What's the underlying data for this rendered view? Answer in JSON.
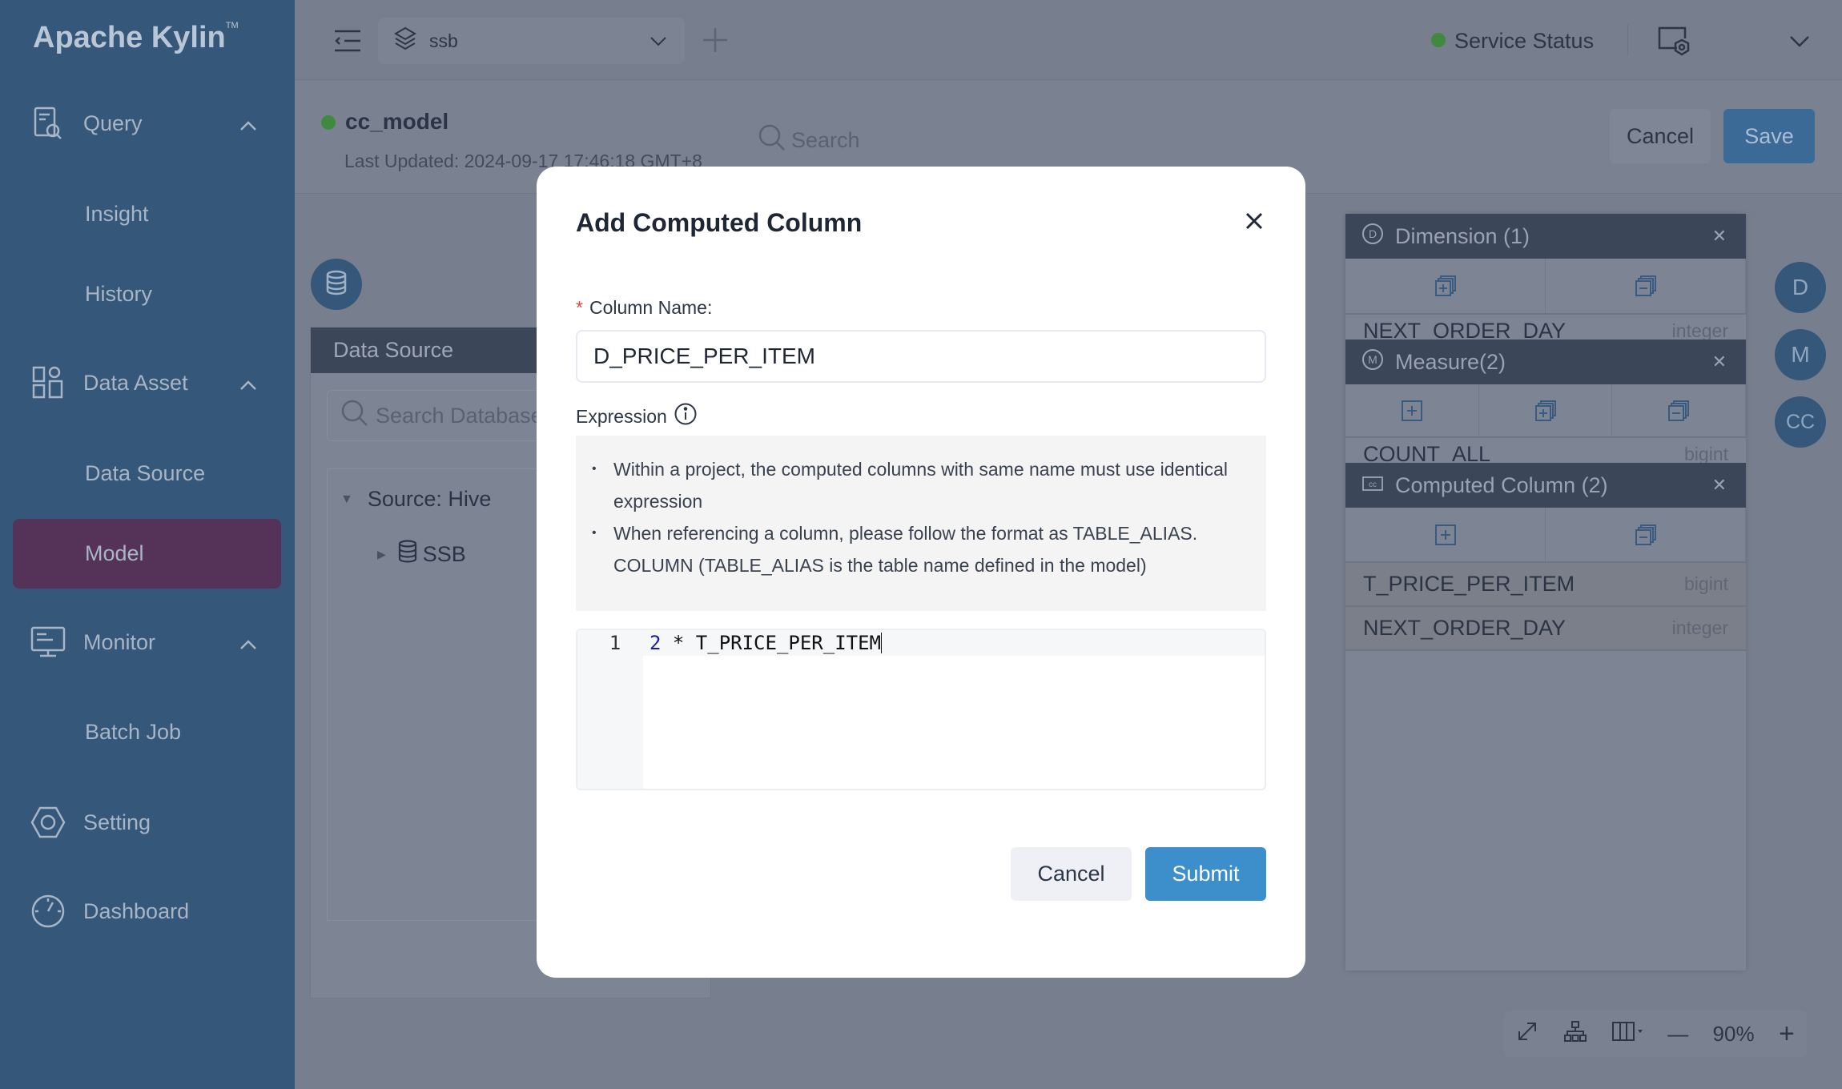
{
  "app": {
    "logo": "Apache Kylin",
    "tm": "TM"
  },
  "sidebar": {
    "items": [
      {
        "label": "Query",
        "icon": "query-icon",
        "expanded": true
      },
      {
        "label": "Insight"
      },
      {
        "label": "History"
      },
      {
        "label": "Data Asset",
        "icon": "data-asset-icon",
        "expanded": true
      },
      {
        "label": "Data Source"
      },
      {
        "label": "Model",
        "active": true
      },
      {
        "label": "Monitor",
        "icon": "monitor-icon",
        "expanded": true
      },
      {
        "label": "Batch Job"
      },
      {
        "label": "Setting",
        "icon": "setting-icon"
      },
      {
        "label": "Dashboard",
        "icon": "dashboard-icon"
      }
    ]
  },
  "header": {
    "project": "ssb",
    "service_status": "Service Status",
    "status_color": "#3f8a3f"
  },
  "model": {
    "name": "cc_model",
    "last_updated": "Last Updated: 2024-09-17 17:46:18 GMT+8",
    "search_placeholder": "Search",
    "cancel": "Cancel",
    "save": "Save"
  },
  "datasource": {
    "title": "Data Source",
    "search_placeholder": "Search Database/Table",
    "source": "Source: Hive",
    "db": "SSB"
  },
  "panel": {
    "dimension": {
      "title": "Dimension (1)",
      "rows": [
        {
          "name": "NEXT_ORDER_DAY",
          "type": "integer"
        }
      ]
    },
    "measure": {
      "title": "Measure(2)",
      "rows": [
        {
          "name": "COUNT_ALL",
          "type": "bigint"
        }
      ]
    },
    "computed": {
      "title": "Computed Column (2)",
      "rows": [
        {
          "name": "T_PRICE_PER_ITEM",
          "type": "bigint"
        },
        {
          "name": "NEXT_ORDER_DAY",
          "type": "integer"
        }
      ]
    }
  },
  "side_circles": [
    "D",
    "M",
    "CC"
  ],
  "toolbar": {
    "zoom": "90%"
  },
  "dialog": {
    "title": "Add Computed Column",
    "column_name_label": "Column Name:",
    "required_mark": "*",
    "column_name_value": "D_PRICE_PER_ITEM",
    "expression_label": "Expression",
    "tips": [
      "Within a project, the computed columns with same name must use identical expression",
      "When referencing a column, please follow the format as TABLE_ALIAS. COLUMN (TABLE_ALIAS is the table name defined in the model)"
    ],
    "code_line_number": "1",
    "code_num": "2",
    "code_rest": " * T_PRICE_PER_ITEM",
    "cancel": "Cancel",
    "submit": "Submit",
    "accent": "#3d8fcc"
  }
}
